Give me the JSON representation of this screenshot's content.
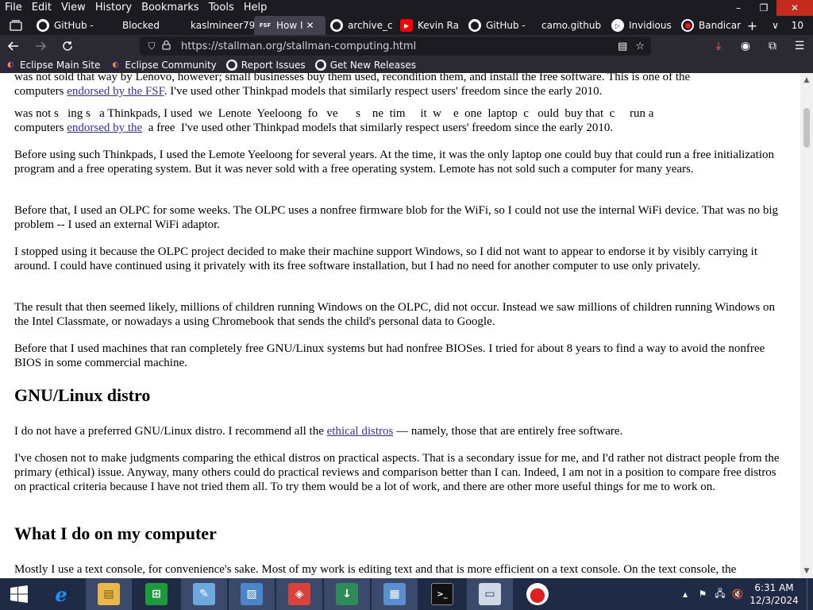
{
  "menubar": {
    "items": [
      "File",
      "Edit",
      "View",
      "History",
      "Bookmarks",
      "Tools",
      "Help"
    ]
  },
  "window_controls": {
    "minimize": "–",
    "maximize": "❐",
    "close": "✕"
  },
  "tabs": [
    {
      "label": "GitHub -",
      "icon": "github-icon",
      "active": false
    },
    {
      "label": "Blocked",
      "icon": "none",
      "active": false
    },
    {
      "label": "kaslmineer79",
      "icon": "none",
      "active": false
    },
    {
      "label": "How I",
      "icon": "site-icon",
      "active": true,
      "close": "✕"
    },
    {
      "label": "archive_c",
      "icon": "github-icon",
      "active": false
    },
    {
      "label": "Kevin Ra",
      "icon": "youtube-icon",
      "active": false
    },
    {
      "label": "GitHub -",
      "icon": "github-icon",
      "active": false
    },
    {
      "label": "camo.github",
      "icon": "none",
      "active": false
    },
    {
      "label": "Invidious",
      "icon": "invidious-icon",
      "active": false
    },
    {
      "label": "Bandicar",
      "icon": "record-icon",
      "active": false
    }
  ],
  "tab_controls": {
    "new_tab": "+",
    "list": "∨",
    "count": "10"
  },
  "navbar": {
    "url": "https://stallman.org/stallman-computing.html"
  },
  "bookmarks": [
    {
      "label": "Eclipse Main Site",
      "icon": "eclipse-icon"
    },
    {
      "label": "Eclipse Community",
      "icon": "eclipse-icon"
    },
    {
      "label": "Report Issues",
      "icon": "github-icon"
    },
    {
      "label": "Get New Releases",
      "icon": "github-icon"
    }
  ],
  "page": {
    "p0_line1": "was not sold that way by Lenovo, however; small businesses buy them used, recondition them, and install the free software. This is one of the",
    "p0_line2_pre": "computers ",
    "p0_line2_link": "endorsed by the FSF",
    "p0_line2_post": ". I've used other Thinkpad models that similarly respect users' freedom since the early 2010.",
    "ghost_line1": "was not s   ing s   a Thinkpads, I used  we  Lenote  Yeeloong  fo   ve      s    ne  tim     it  w    e  one  laptop  c   ould  buy that  c     run a",
    "ghost_line2_pre": "computers ",
    "ghost_line2_link": "endorsed by the",
    "ghost_line2_post": "  a free  I've used other Thinkpad models that similarly respect users' freedom since the early 2010.",
    "p1": "Before using such Thinkpads, I used the Lemote Yeeloong for several years. At the time, it was the only laptop one could buy that could run a free initialization program and a free operating system. But it was never sold with a free operating system. Lemote has not sold such a computer for many years.",
    "p2": "Before that, I used an OLPC for some weeks. The OLPC uses a nonfree firmware blob for the WiFi, so I could not use the internal WiFi device. That was no big problem -- I used an external WiFi adaptor.",
    "p3": "I stopped using it because the OLPC project decided to make their machine support Windows, so I did not want to appear to endorse it by visibly carrying it around. I could have continued using it privately with its free software installation, but I had no need for another computer to use only privately.",
    "p4": "The result that then seemed likely, millions of children running Windows on the OLPC, did not occur. Instead we saw millions of children running Windows on the Intel Classmate, or nowadays a using Chromebook that sends the child's personal data to Google.",
    "p5": "Before that I used machines that ran completely free GNU/Linux systems but had nonfree BIOSes. I tried for about 8 years to find a way to avoid the nonfree BIOS in some commercial machine.",
    "h_distro": "GNU/Linux distro",
    "p6_pre": "I do not have a preferred GNU/Linux distro. I recommend all the ",
    "p6_link": "ethical distros",
    "p6_post": " — namely, those that are entirely free software.",
    "p7": "I've chosen not to make judgments comparing the ethical distros on practical aspects. That is a secondary issue for me, and I'd rather not distract people from the primary (ethical) issue. Anyway, many others could do practical reviews and comparison better than I can. Indeed, I am not in a position to compare free distros on practical criteria because I have not tried them all. To try them would be a lot of work, and there are other more useful things for me to work on.",
    "h_what": "What I do on my computer",
    "p8": "Mostly I use a text console, for convenience's sake. Most of my work is editing text and that is more efficient on a text console. On the text console, the"
  },
  "taskbar": {
    "apps": [
      {
        "name": "internet-explorer",
        "glyph": "e",
        "color": "#1e90ff"
      },
      {
        "name": "file-explorer",
        "glyph": "▤",
        "color": "#e8b84a"
      },
      {
        "name": "store",
        "glyph": "⊞",
        "color": "#1c9a3c"
      },
      {
        "name": "notepad",
        "glyph": "✎",
        "color": "#6fa8dc"
      },
      {
        "name": "photo-viewer",
        "glyph": "▨",
        "color": "#4a86c8"
      },
      {
        "name": "red-app",
        "glyph": "◈",
        "color": "#d9423a"
      },
      {
        "name": "download-manager",
        "glyph": "↓",
        "color": "#2e8b57"
      },
      {
        "name": "control-panel",
        "glyph": "▦",
        "color": "#5a8fd0"
      },
      {
        "name": "command-prompt",
        "glyph": ">_",
        "color": "#111111"
      },
      {
        "name": "window-app",
        "glyph": "▭",
        "color": "#cfd8e6"
      },
      {
        "name": "recorder",
        "glyph": "●",
        "color": "#e02020"
      }
    ]
  },
  "tray": {
    "time": "6:31 AM",
    "date": "12/3/2024"
  },
  "colors": {
    "link": "#3030c0",
    "browser_dark": "#1c1b22",
    "toolbar": "#2b2a33",
    "taskbar": "#1f2a44"
  }
}
